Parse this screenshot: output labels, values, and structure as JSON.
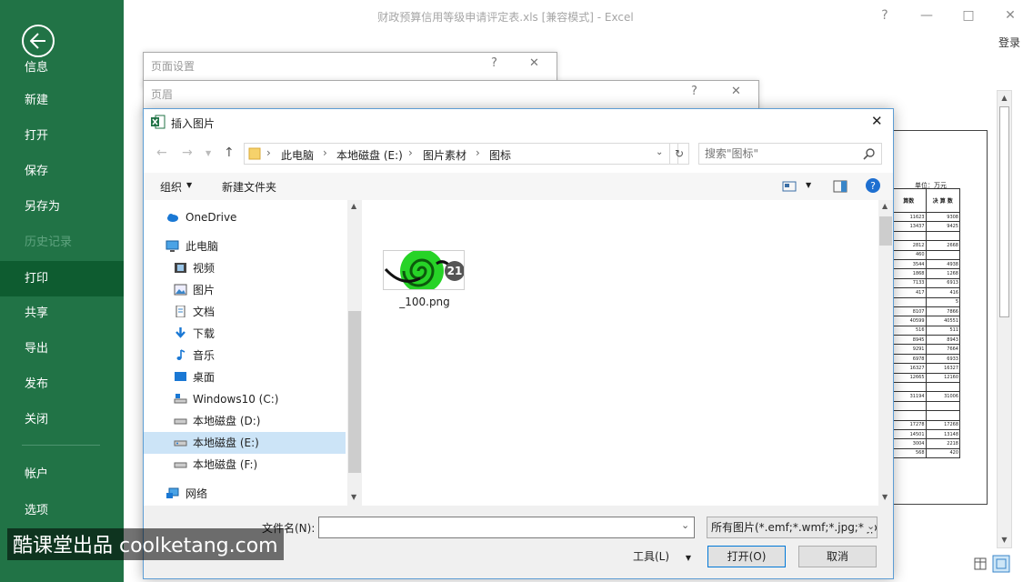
{
  "app": {
    "title": "财政预算信用等级申请评定表.xls  [兼容模式] - Excel",
    "help": "?",
    "minimize": "—",
    "maximize": "□",
    "close": "✕",
    "login": "登录"
  },
  "sidebar": {
    "info": "信息",
    "items": [
      {
        "label": "新建"
      },
      {
        "label": "打开"
      },
      {
        "label": "保存"
      },
      {
        "label": "另存为"
      },
      {
        "label": "历史记录"
      },
      {
        "label": "打印"
      },
      {
        "label": "共享"
      },
      {
        "label": "导出"
      },
      {
        "label": "发布"
      },
      {
        "label": "关闭"
      },
      {
        "label": "帐户"
      },
      {
        "label": "选项"
      }
    ],
    "active": "打印",
    "accent": "#217346"
  },
  "bg_dialogs": [
    {
      "title": "页面设置",
      "help": "?",
      "close": "✕"
    },
    {
      "title": "页眉",
      "help": "?",
      "close": "✕"
    }
  ],
  "dialog": {
    "title": "插入图片",
    "breadcrumb": [
      "此电脑",
      "本地磁盘 (E:)",
      "图片素材",
      "图标"
    ],
    "search_placeholder": "搜索\"图标\"",
    "toolbar": {
      "organize": "组织",
      "new_folder": "新建文件夹"
    },
    "nav": [
      {
        "label": "OneDrive",
        "icon": "cloud-icon"
      },
      {
        "label": "此电脑",
        "icon": "computer-icon"
      },
      {
        "label": "视频",
        "icon": "video-icon"
      },
      {
        "label": "图片",
        "icon": "picture-icon"
      },
      {
        "label": "文档",
        "icon": "document-icon"
      },
      {
        "label": "下载",
        "icon": "download-icon"
      },
      {
        "label": "音乐",
        "icon": "music-icon"
      },
      {
        "label": "桌面",
        "icon": "desktop-icon"
      },
      {
        "label": "Windows10 (C:)",
        "icon": "drive-icon"
      },
      {
        "label": "本地磁盘 (D:)",
        "icon": "drive-icon"
      },
      {
        "label": "本地磁盘 (E:)",
        "icon": "drive-icon"
      },
      {
        "label": "本地磁盘 (F:)",
        "icon": "drive-icon"
      },
      {
        "label": "网络",
        "icon": "network-icon"
      }
    ],
    "selected_nav": "本地磁盘 (E:)",
    "files": [
      {
        "name": "_100.png",
        "badge": "21"
      }
    ],
    "filename_label": "文件名(N):",
    "filename_value": "",
    "filter": "所有图片(*.emf;*.wmf;*.jpg;*.jpeg;*.png)",
    "tools": "工具(L)",
    "open": "打开(O)",
    "cancel": "取消"
  },
  "preview": {
    "unit": "单位：万元",
    "headers": [
      "算数",
      "决 算 数"
    ],
    "rows": [
      [
        "11623",
        "9308"
      ],
      [
        "13437",
        "9425"
      ],
      [
        "",
        ""
      ],
      [
        "2812",
        "2668"
      ],
      [
        "460",
        ""
      ],
      [
        "3544",
        "4938"
      ],
      [
        "1868",
        "1268"
      ],
      [
        "7133",
        "6913"
      ],
      [
        "417",
        "416"
      ],
      [
        "",
        "5"
      ],
      [
        "8107",
        "7866"
      ],
      [
        "40599",
        "40551"
      ],
      [
        "516",
        "511"
      ],
      [
        "8945",
        "8943"
      ],
      [
        "9291",
        "7664"
      ],
      [
        "6978",
        "6933"
      ],
      [
        "16327",
        "16327"
      ],
      [
        "12665",
        "12160"
      ],
      [
        "",
        ""
      ],
      [
        "31194",
        "31006"
      ],
      [
        "",
        ""
      ],
      [
        "",
        ""
      ],
      [
        "17278",
        "17268"
      ],
      [
        "14501",
        "13148"
      ],
      [
        "3004",
        "2218"
      ],
      [
        "568",
        "420"
      ]
    ]
  },
  "watermark": "酷课堂出品 coolketang.com"
}
